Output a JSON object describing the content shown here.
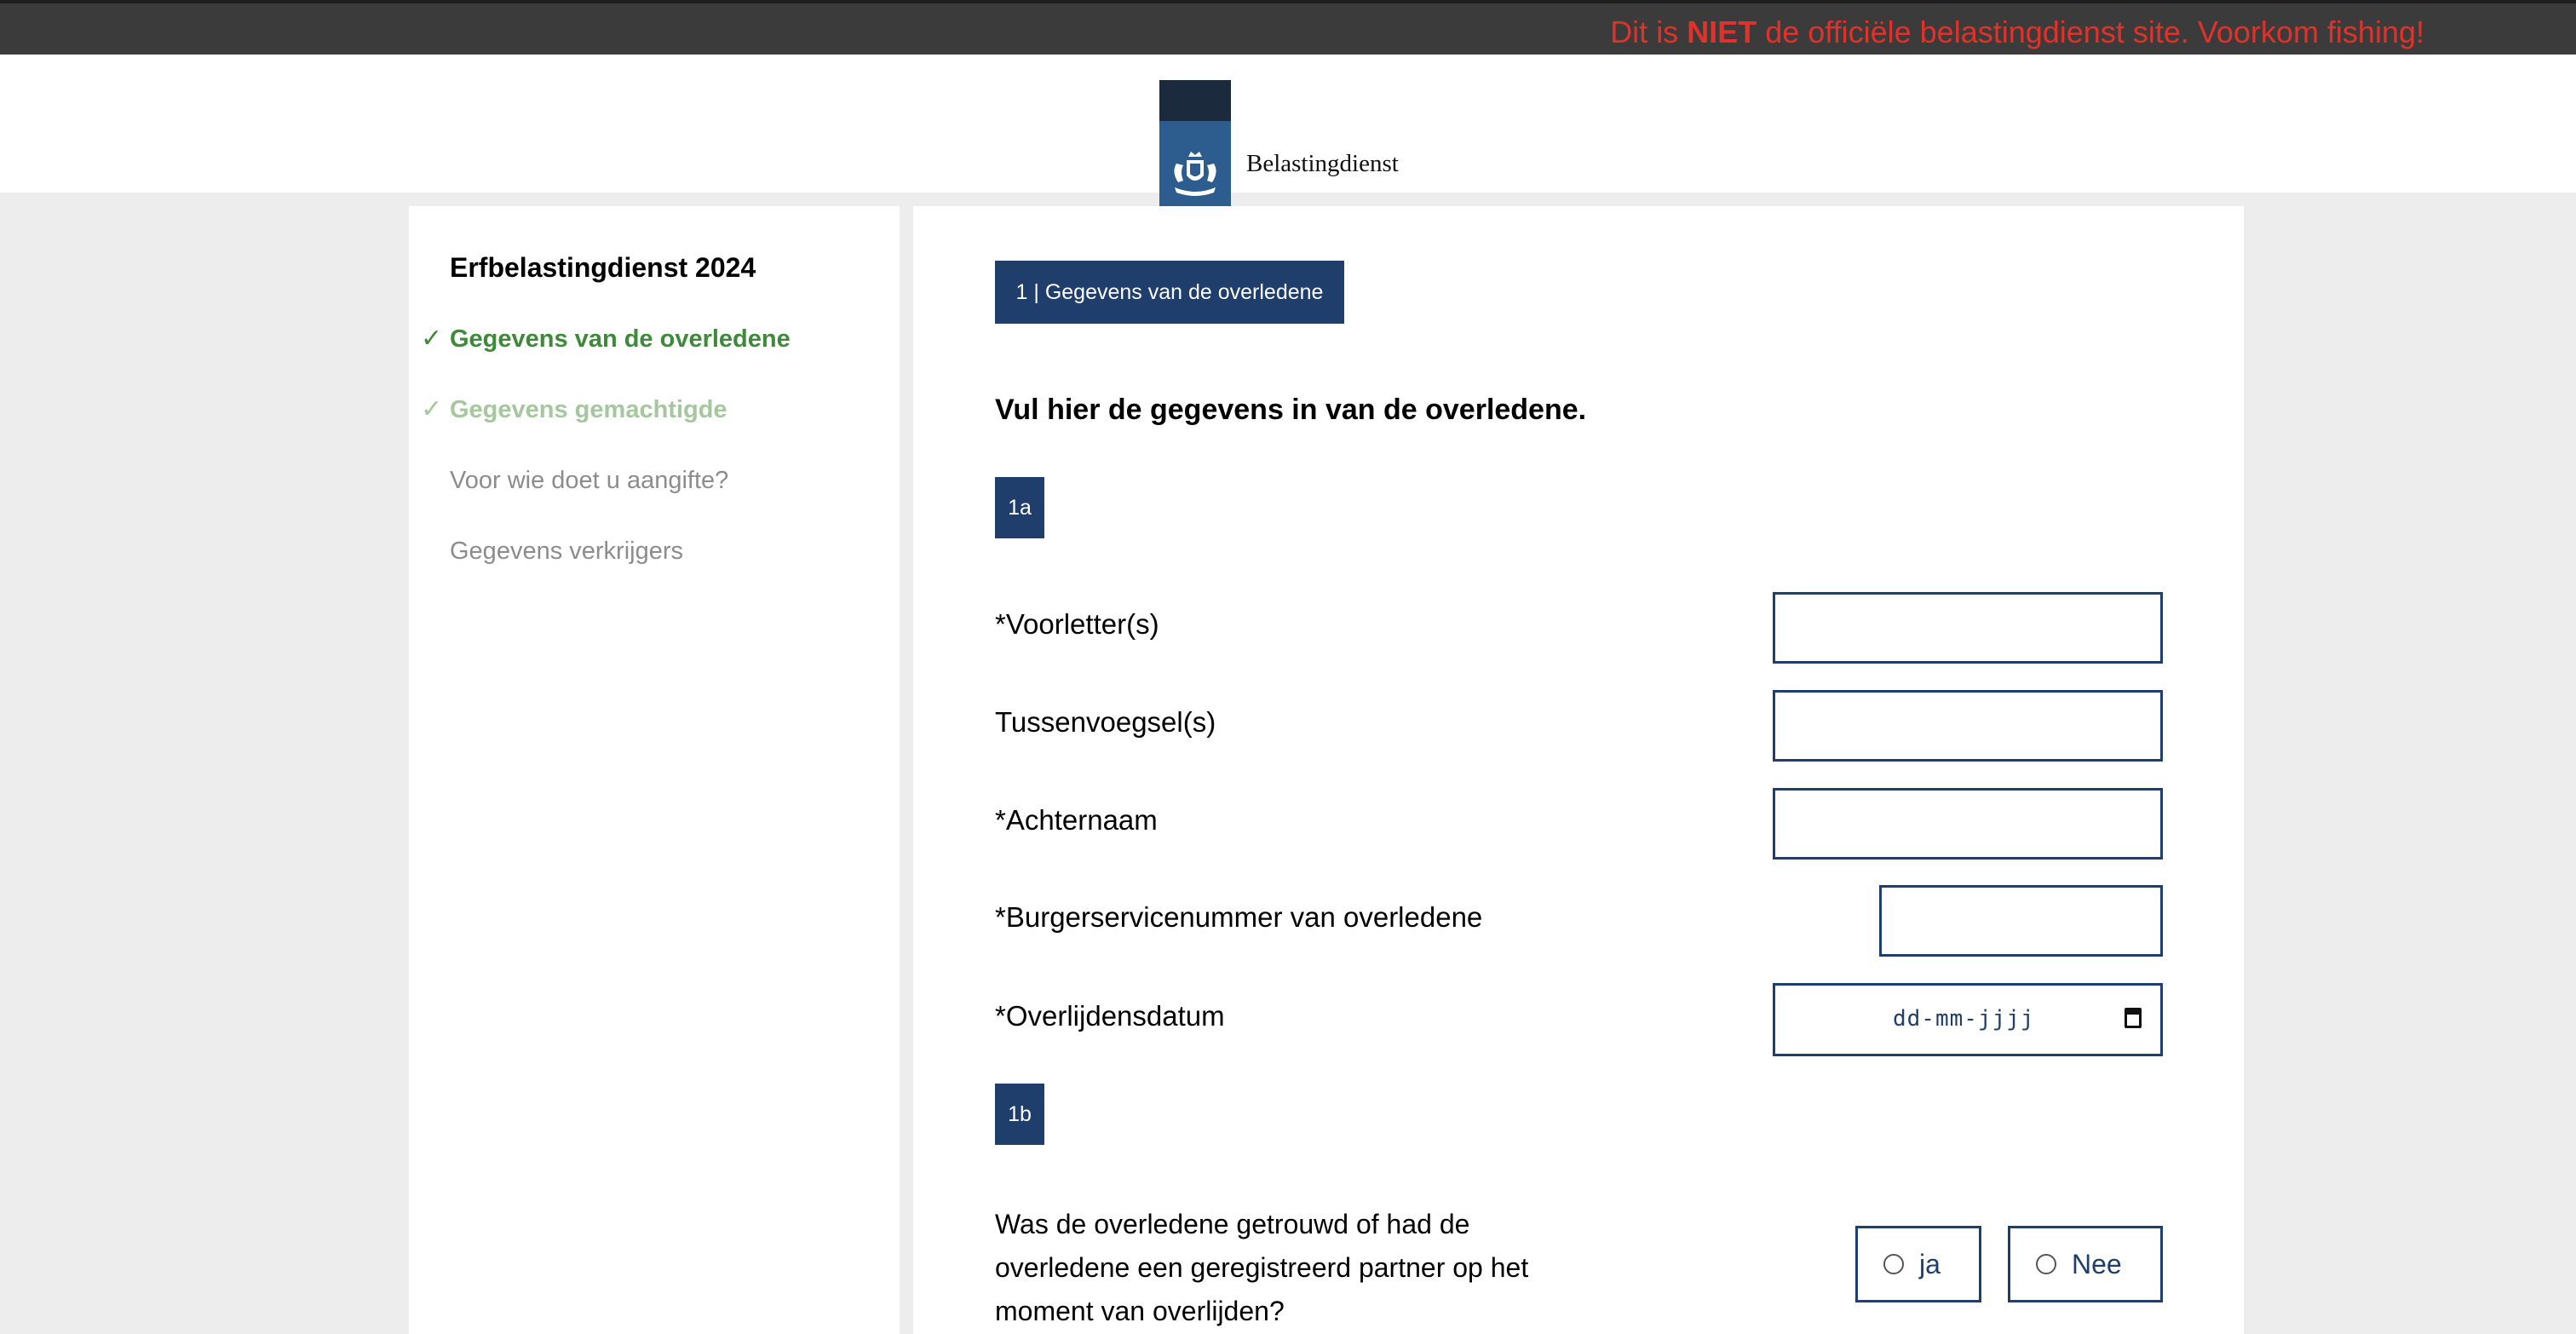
{
  "banner": {
    "warning_prefix": "Dit is ",
    "warning_bold": "NIET",
    "warning_suffix": " de officiële belastingdienst site. Voorkom fishing!",
    "warning_color": "#e0322a"
  },
  "header": {
    "logo_text": "Belastingdienst",
    "logo_icon": "royal-coat-of-arms-icon",
    "logo_color": "#2d5c8f"
  },
  "sidebar": {
    "title": "Erfbelastingdienst 2024",
    "steps": [
      {
        "label": "Gegevens van de overledene",
        "status": "completed",
        "icon": "checkmark-icon"
      },
      {
        "label": "Gegevens gemachtigde",
        "status": "completed",
        "icon": "checkmark-icon"
      },
      {
        "label": "Voor wie doet u aangifte?",
        "status": "pending"
      },
      {
        "label": "Gegevens verkrijgers",
        "status": "pending"
      }
    ],
    "check_glyph": "✓"
  },
  "form": {
    "section_badge": "1 | Gegevens van de overledene",
    "intro": "Vul hier de gegevens in van de overledene.",
    "subsection_1a": "1a",
    "fields": {
      "initials_label": "*Voorletter(s)",
      "initials_value": "",
      "infix_label": "Tussenvoegsel(s)",
      "infix_value": "",
      "surname_label": "*Achternaam",
      "surname_value": "",
      "bsn_label": "*Burgerservicenummer van overledene",
      "bsn_value": "",
      "date_label": "*Overlijdensdatum",
      "date_placeholder": "dd-mm-jjjj"
    },
    "subsection_1b": "1b",
    "question": "Was de overledene getrouwd of had de overledene een geregistreerd partner op het moment van overlijden?",
    "options": [
      {
        "label": "ja",
        "selected": false
      },
      {
        "label": "Nee",
        "selected": false
      }
    ],
    "accent_color": "#1f3e6b"
  }
}
